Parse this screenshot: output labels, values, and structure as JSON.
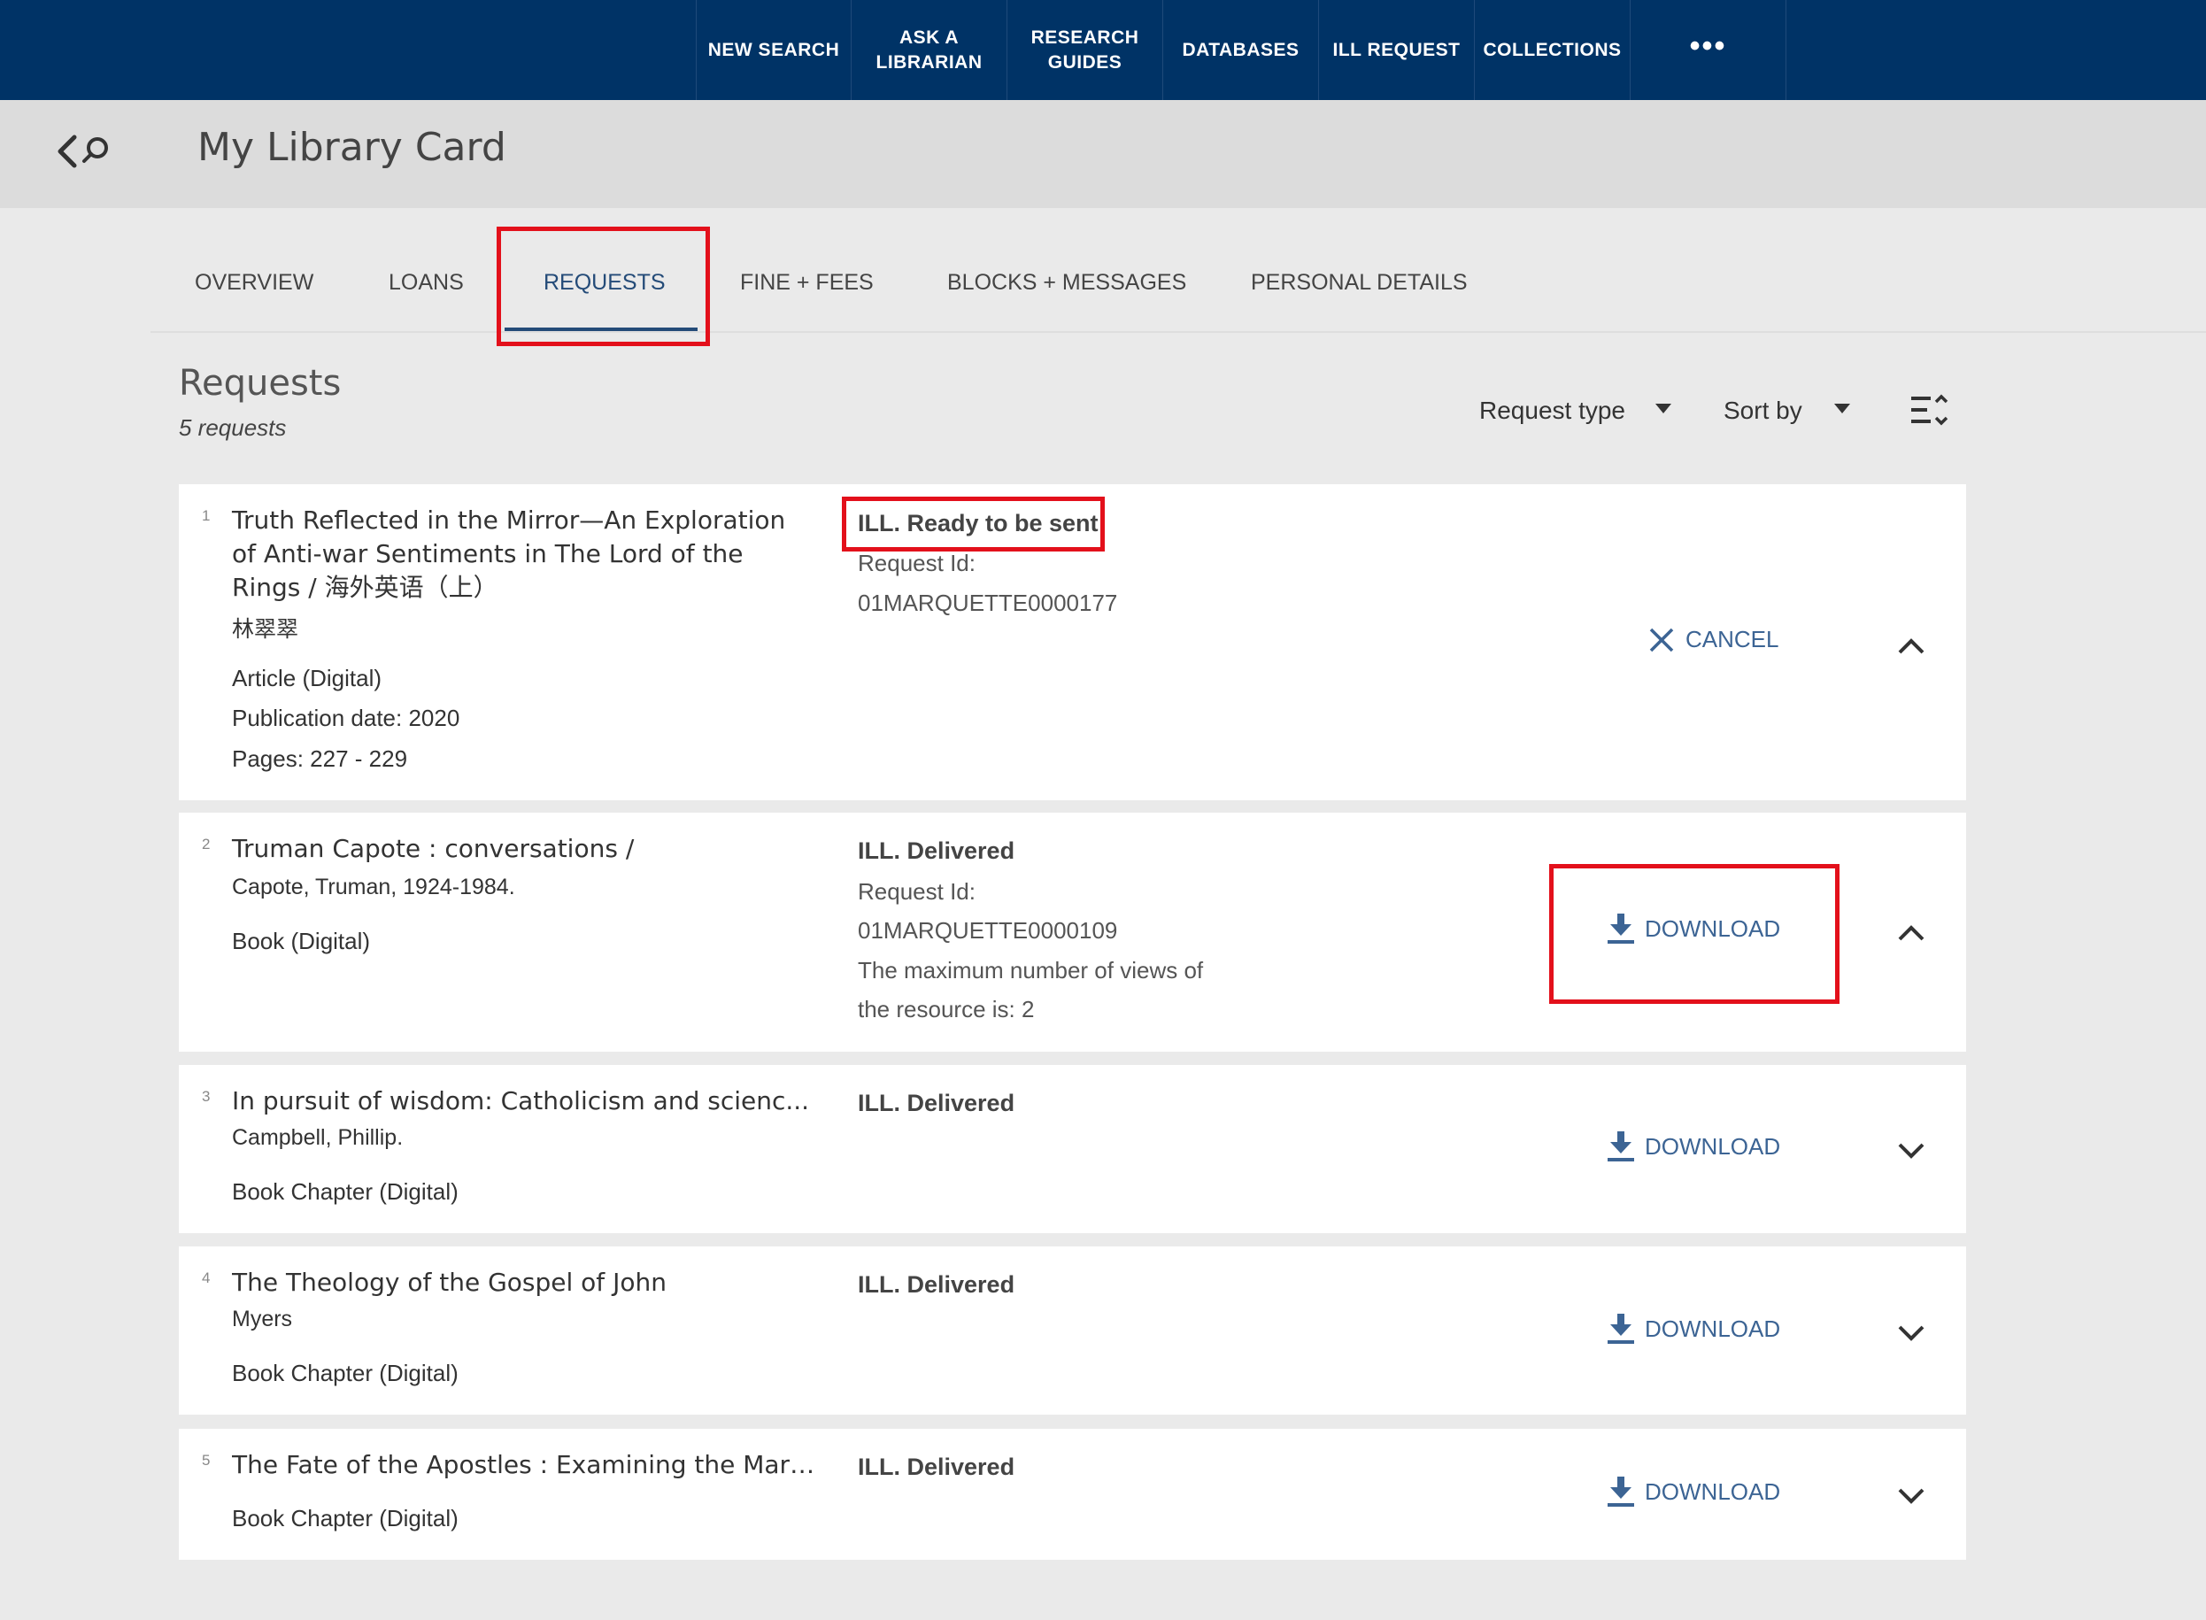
{
  "nav": {
    "items": [
      "NEW SEARCH",
      "ASK A\nLIBRARIAN",
      "RESEARCH\nGUIDES",
      "DATABASES",
      "ILL REQUEST",
      "COLLECTIONS"
    ],
    "more_label": "•••"
  },
  "header": {
    "title": "My Library Card"
  },
  "tabs": [
    "OVERVIEW",
    "LOANS",
    "REQUESTS",
    "FINE + FEES",
    "BLOCKS + MESSAGES",
    "PERSONAL DETAILS"
  ],
  "active_tab": "REQUESTS",
  "requests_section": {
    "heading": "Requests",
    "count": "5 requests",
    "request_type_label": "Request type",
    "sort_label": "Sort by"
  },
  "requests": [
    {
      "num": "1",
      "title": "Truth Reflected in the Mirror—An Exploration of Anti-war Sentiments in The Lord of the Rings / 海外英语（上）",
      "author": "林翠翠",
      "type": "Article (Digital)",
      "pub_date": "Publication date: 2020",
      "pages": "Pages: 227 - 229",
      "status": "ILL. Ready to be sent",
      "request_id_label": "Request Id:",
      "request_id": "01MARQUETTE0000177",
      "action": "CANCEL",
      "expanded": true
    },
    {
      "num": "2",
      "title": "Truman Capote : conversations /",
      "author": "Capote, Truman, 1924-1984.",
      "type": "Book (Digital)",
      "status": "ILL. Delivered",
      "request_id_label": "Request Id:",
      "request_id": "01MARQUETTE0000109",
      "note_line1": "The maximum number of views of",
      "note_line2": "the resource is: 2",
      "action": "DOWNLOAD",
      "expanded": true
    },
    {
      "num": "3",
      "title": "In pursuit of wisdom: Catholicism and scienc...",
      "author": "Campbell, Phillip.",
      "type": "Book Chapter (Digital)",
      "status": "ILL. Delivered",
      "action": "DOWNLOAD",
      "expanded": false
    },
    {
      "num": "4",
      "title": "The Theology of the Gospel of John",
      "author": "Myers",
      "type": "Book Chapter (Digital)",
      "status": "ILL. Delivered",
      "action": "DOWNLOAD",
      "expanded": false
    },
    {
      "num": "5",
      "title": "The Fate of the Apostles : Examining the Mart...",
      "type": "Book Chapter (Digital)",
      "status": "ILL. Delivered",
      "action": "DOWNLOAD",
      "expanded": false
    }
  ],
  "colors": {
    "nav_bg": "#003366",
    "accent": "#3c6494",
    "highlight": "#e3101b"
  }
}
